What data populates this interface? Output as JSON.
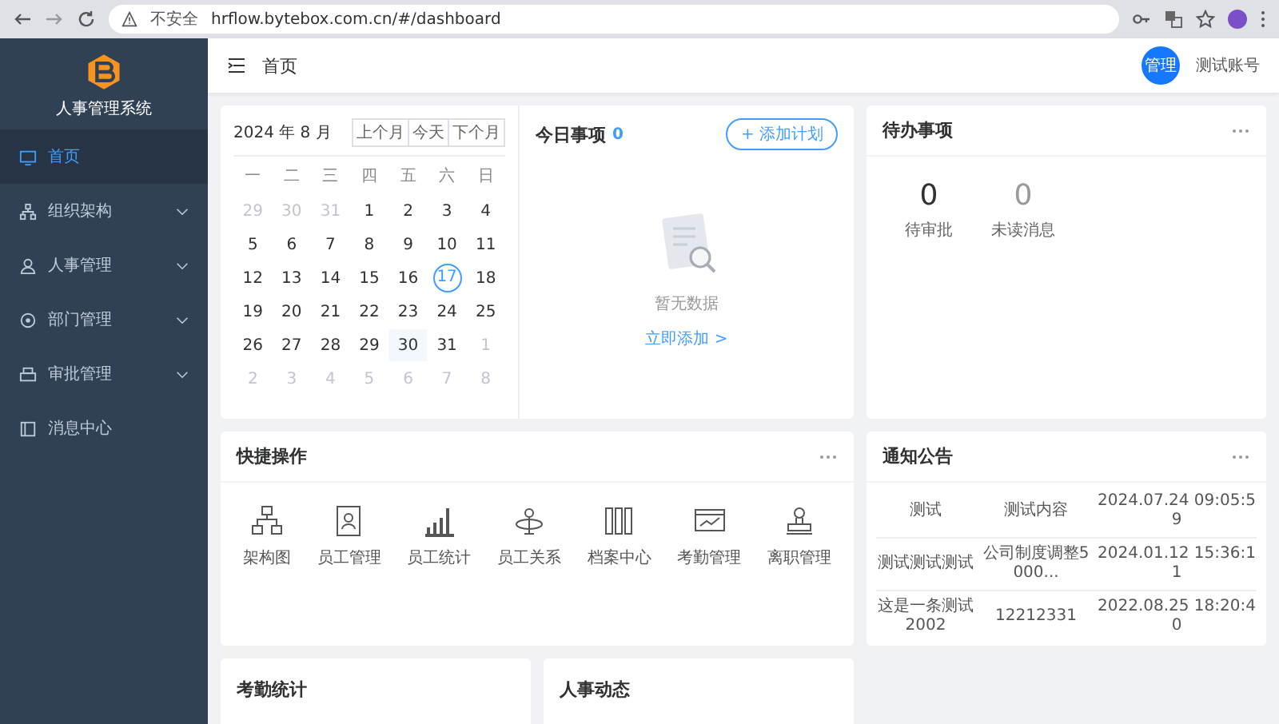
{
  "browser": {
    "security_label": "不安全",
    "url": "hrflow.bytebox.com.cn/#/dashboard"
  },
  "sidebar": {
    "app_name": "人事管理系统",
    "items": [
      {
        "label": "首页",
        "selected": true,
        "expandable": false
      },
      {
        "label": "组织架构",
        "selected": false,
        "expandable": true
      },
      {
        "label": "人事管理",
        "selected": false,
        "expandable": true
      },
      {
        "label": "部门管理",
        "selected": false,
        "expandable": true
      },
      {
        "label": "审批管理",
        "selected": false,
        "expandable": true
      },
      {
        "label": "消息中心",
        "selected": false,
        "expandable": false
      }
    ]
  },
  "header": {
    "title": "首页",
    "avatar_text": "管理",
    "username": "测试账号"
  },
  "calendar": {
    "title": "2024 年 8 月",
    "buttons": [
      "上个月",
      "今天",
      "下个月"
    ],
    "weekdays": [
      "一",
      "二",
      "三",
      "四",
      "五",
      "六",
      "日"
    ],
    "weeks": [
      [
        {
          "day": "29",
          "in_month": false,
          "today": false,
          "selected": false
        },
        {
          "day": "30",
          "in_month": false,
          "today": false,
          "selected": false
        },
        {
          "day": "31",
          "in_month": false,
          "today": false,
          "selected": false
        },
        {
          "day": "1",
          "in_month": true,
          "today": false,
          "selected": false
        },
        {
          "day": "2",
          "in_month": true,
          "today": false,
          "selected": false
        },
        {
          "day": "3",
          "in_month": true,
          "today": false,
          "selected": false
        },
        {
          "day": "4",
          "in_month": true,
          "today": false,
          "selected": false
        }
      ],
      [
        {
          "day": "5",
          "in_month": true,
          "today": false,
          "selected": false
        },
        {
          "day": "6",
          "in_month": true,
          "today": false,
          "selected": false
        },
        {
          "day": "7",
          "in_month": true,
          "today": false,
          "selected": false
        },
        {
          "day": "8",
          "in_month": true,
          "today": false,
          "selected": false
        },
        {
          "day": "9",
          "in_month": true,
          "today": false,
          "selected": false
        },
        {
          "day": "10",
          "in_month": true,
          "today": false,
          "selected": false
        },
        {
          "day": "11",
          "in_month": true,
          "today": false,
          "selected": false
        }
      ],
      [
        {
          "day": "12",
          "in_month": true,
          "today": false,
          "selected": false
        },
        {
          "day": "13",
          "in_month": true,
          "today": false,
          "selected": false
        },
        {
          "day": "14",
          "in_month": true,
          "today": false,
          "selected": false
        },
        {
          "day": "15",
          "in_month": true,
          "today": false,
          "selected": false
        },
        {
          "day": "16",
          "in_month": true,
          "today": false,
          "selected": false
        },
        {
          "day": "17",
          "in_month": true,
          "today": true,
          "selected": false
        },
        {
          "day": "18",
          "in_month": true,
          "today": false,
          "selected": false
        }
      ],
      [
        {
          "day": "19",
          "in_month": true,
          "today": false,
          "selected": false
        },
        {
          "day": "20",
          "in_month": true,
          "today": false,
          "selected": false
        },
        {
          "day": "21",
          "in_month": true,
          "today": false,
          "selected": false
        },
        {
          "day": "22",
          "in_month": true,
          "today": false,
          "selected": false
        },
        {
          "day": "23",
          "in_month": true,
          "today": false,
          "selected": false
        },
        {
          "day": "24",
          "in_month": true,
          "today": false,
          "selected": false
        },
        {
          "day": "25",
          "in_month": true,
          "today": false,
          "selected": false
        }
      ],
      [
        {
          "day": "26",
          "in_month": true,
          "today": false,
          "selected": false
        },
        {
          "day": "27",
          "in_month": true,
          "today": false,
          "selected": false
        },
        {
          "day": "28",
          "in_month": true,
          "today": false,
          "selected": false
        },
        {
          "day": "29",
          "in_month": true,
          "today": false,
          "selected": false
        },
        {
          "day": "30",
          "in_month": true,
          "today": false,
          "selected": true
        },
        {
          "day": "31",
          "in_month": true,
          "today": false,
          "selected": false
        },
        {
          "day": "1",
          "in_month": false,
          "today": false,
          "selected": false
        }
      ],
      [
        {
          "day": "2",
          "in_month": false,
          "today": false,
          "selected": false
        },
        {
          "day": "3",
          "in_month": false,
          "today": false,
          "selected": false
        },
        {
          "day": "4",
          "in_month": false,
          "today": false,
          "selected": false
        },
        {
          "day": "5",
          "in_month": false,
          "today": false,
          "selected": false
        },
        {
          "day": "6",
          "in_month": false,
          "today": false,
          "selected": false
        },
        {
          "day": "7",
          "in_month": false,
          "today": false,
          "selected": false
        },
        {
          "day": "8",
          "in_month": false,
          "today": false,
          "selected": false
        }
      ]
    ]
  },
  "today_tasks": {
    "title": "今日事项",
    "count": "0",
    "add_button": "+ 添加计划",
    "empty_text": "暂无数据",
    "link": "立即添加 >"
  },
  "todo": {
    "title": "待办事项",
    "stats": [
      {
        "value": "0",
        "label": "待审批",
        "dimmed": false
      },
      {
        "value": "0",
        "label": "未读消息",
        "dimmed": true
      }
    ]
  },
  "quick_actions": {
    "title": "快捷操作",
    "items": [
      "架构图",
      "员工管理",
      "员工统计",
      "员工关系",
      "档案中心",
      "考勤管理",
      "离职管理"
    ]
  },
  "notices": {
    "title": "通知公告",
    "rows": [
      [
        "测试",
        "测试内容",
        "2024.07.24 09:05:59"
      ],
      [
        "测试测试测试",
        "公司制度调整5000...",
        "2024.01.12 15:36:11"
      ],
      [
        "这是一条测试2002",
        "12212331",
        "2022.08.25 18:20:40"
      ]
    ]
  },
  "bottom_cards": [
    {
      "title": "考勤统计"
    },
    {
      "title": "人事动态"
    }
  ]
}
